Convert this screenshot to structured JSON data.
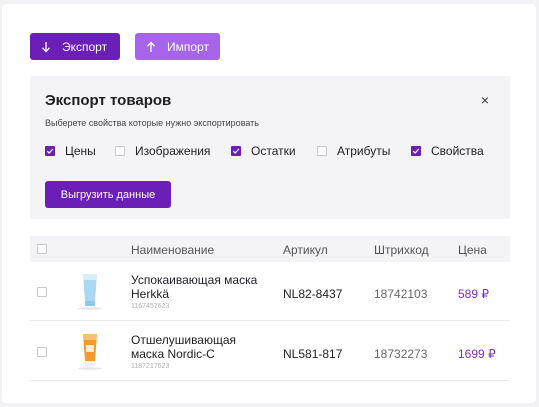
{
  "toolbar": {
    "export_label": "Экспорт",
    "import_label": "Импорт"
  },
  "export_panel": {
    "title": "Экспорт товаров",
    "subtitle": "Выберете свойства которые нужно экспортировать",
    "close_glyph": "×",
    "options": [
      {
        "label": "Цены",
        "checked": true
      },
      {
        "label": "Изображения",
        "checked": false
      },
      {
        "label": "Остатки",
        "checked": true
      },
      {
        "label": "Атрибуты",
        "checked": false
      },
      {
        "label": "Свойства",
        "checked": true
      }
    ],
    "submit_label": "Выгрузить данные"
  },
  "table": {
    "columns": [
      "Наименование",
      "Артикул",
      "Штрихкод",
      "Цена"
    ],
    "rows": [
      {
        "name": "Успокаивающая маска Herkkä",
        "id": "1167457623",
        "sku": "NL82-8437",
        "barcode": "18742103",
        "price": "589 ₽",
        "image": "blue-tube-icon"
      },
      {
        "name": "Отшелушивающая маска Nordic-C",
        "id": "1187217623",
        "sku": "NL581-817",
        "barcode": "18732273",
        "price": "1699 ₽",
        "image": "orange-tube-icon"
      }
    ]
  },
  "colors": {
    "primary": "#6c1fb7",
    "primary_light": "#a763e9",
    "price": "#7b2fc1",
    "panel_bg": "#f4f4f6"
  }
}
